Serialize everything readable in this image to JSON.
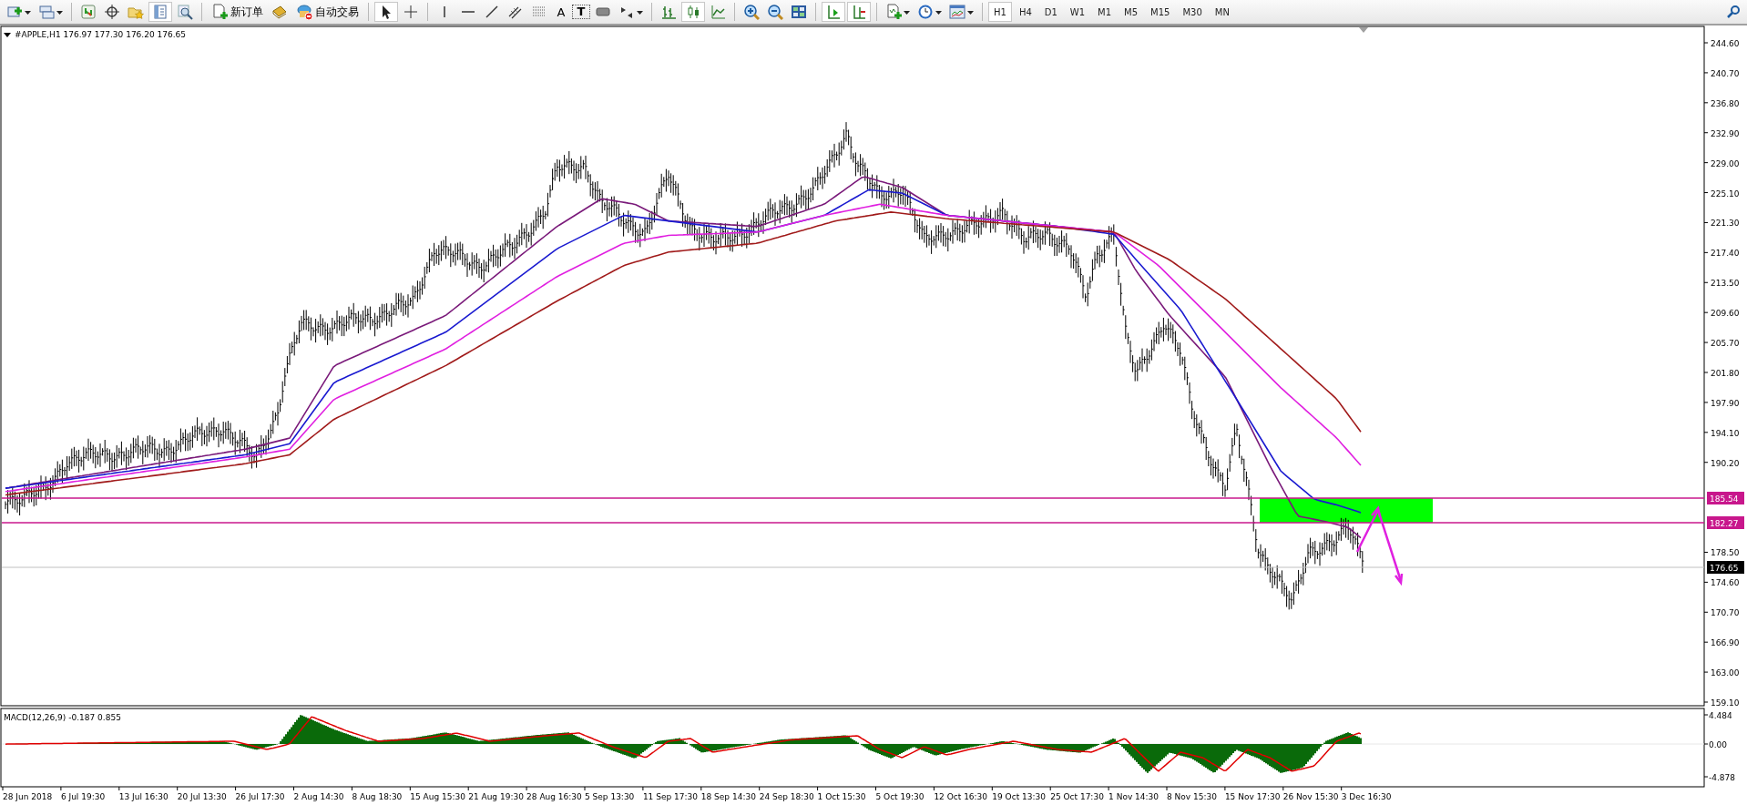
{
  "toolbar": {
    "new_order": "新订单",
    "auto_trading": "自动交易",
    "text_tool": "A",
    "label_tool": "T",
    "timeframes": [
      {
        "label": "H1",
        "selected": true
      },
      {
        "label": "H4",
        "selected": false
      },
      {
        "label": "D1",
        "selected": false
      },
      {
        "label": "W1",
        "selected": false
      },
      {
        "label": "M1",
        "selected": false
      },
      {
        "label": "M5",
        "selected": false
      },
      {
        "label": "M15",
        "selected": false
      },
      {
        "label": "M30",
        "selected": false
      },
      {
        "label": "MN",
        "selected": false
      }
    ]
  },
  "chart": {
    "title": "#APPLE,H1 176.97 177.30 176.20 176.65",
    "price_axis": [
      "244.60",
      "240.70",
      "236.80",
      "232.90",
      "229.00",
      "225.10",
      "221.30",
      "217.40",
      "213.50",
      "209.60",
      "205.70",
      "201.80",
      "197.90",
      "194.10",
      "190.20",
      "178.50",
      "174.60",
      "170.70",
      "166.90",
      "163.00",
      "159.10"
    ],
    "price_lines": [
      {
        "kind": "level",
        "label": "185.54"
      },
      {
        "kind": "level",
        "label": "182.27"
      },
      {
        "kind": "current",
        "label": "176.65"
      }
    ],
    "time_axis": [
      "28 Jun 2018",
      "6 Jul 19:30",
      "13 Jul 16:30",
      "20 Jul 13:30",
      "26 Jul 17:30",
      "2 Aug 14:30",
      "8 Aug 18:30",
      "15 Aug 15:30",
      "21 Aug 19:30",
      "28 Aug 16:30",
      "5 Sep 13:30",
      "11 Sep 17:30",
      "18 Sep 14:30",
      "24 Sep 18:30",
      "1 Oct 15:30",
      "5 Oct 19:30",
      "12 Oct 16:30",
      "19 Oct 13:30",
      "25 Oct 17:30",
      "1 Nov 14:30",
      "8 Nov 15:30",
      "15 Nov 17:30",
      "26 Nov 15:30",
      "3 Dec 16:30"
    ]
  },
  "macd": {
    "title": "MACD(12,26,9) -0.187 0.855",
    "axis": [
      "4.484",
      "0.00",
      "-4.878"
    ]
  }
}
